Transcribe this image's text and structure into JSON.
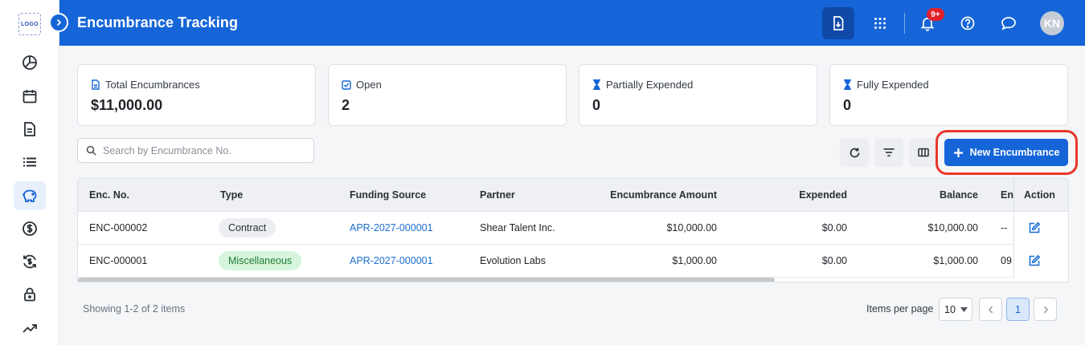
{
  "sidebar": {
    "logo_text": "LOGO",
    "items": [
      {
        "icon": "pie-chart-icon"
      },
      {
        "icon": "calendar-icon"
      },
      {
        "icon": "document-icon"
      },
      {
        "icon": "list-icon"
      },
      {
        "icon": "piggy-bank-icon",
        "active": true
      },
      {
        "icon": "dollar-circle-icon"
      },
      {
        "icon": "refresh-dollar-icon"
      },
      {
        "icon": "lock-icon"
      },
      {
        "icon": "trending-up-icon"
      }
    ]
  },
  "header": {
    "title": "Encumbrance Tracking",
    "notification_badge": "9+",
    "avatar_initials": "KN",
    "accent_color": "#1565d8"
  },
  "stats": [
    {
      "label": "Total Encumbrances",
      "value": "$11,000.00",
      "icon": "document-icon"
    },
    {
      "label": "Open",
      "value": "2",
      "icon": "checkbox-icon"
    },
    {
      "label": "Partially Expended",
      "value": "0",
      "icon": "hourglass-icon"
    },
    {
      "label": "Fully Expended",
      "value": "0",
      "icon": "hourglass-icon"
    }
  ],
  "toolbar": {
    "search_placeholder": "Search by Encumbrance No.",
    "new_button_label": "New Encumbrance"
  },
  "table": {
    "columns": [
      "Enc. No.",
      "Type",
      "Funding Source",
      "Partner",
      "Encumbrance Amount",
      "Expended",
      "Balance",
      "En",
      "Action"
    ],
    "rows": [
      {
        "enc_no": "ENC-000002",
        "type": "Contract",
        "funding_source": "APR-2027-000001",
        "partner": "Shear Talent Inc.",
        "amount": "$10,000.00",
        "expended": "$0.00",
        "balance": "$10,000.00",
        "end": "--"
      },
      {
        "enc_no": "ENC-000001",
        "type": "Miscellaneous",
        "funding_source": "APR-2027-000001",
        "partner": "Evolution Labs",
        "amount": "$1,000.00",
        "expended": "$0.00",
        "balance": "$1,000.00",
        "end": "09"
      }
    ]
  },
  "footer": {
    "showing": "Showing 1-2 of 2 items",
    "items_per_page_label": "Items per page",
    "items_per_page_value": "10",
    "current_page": "1"
  }
}
